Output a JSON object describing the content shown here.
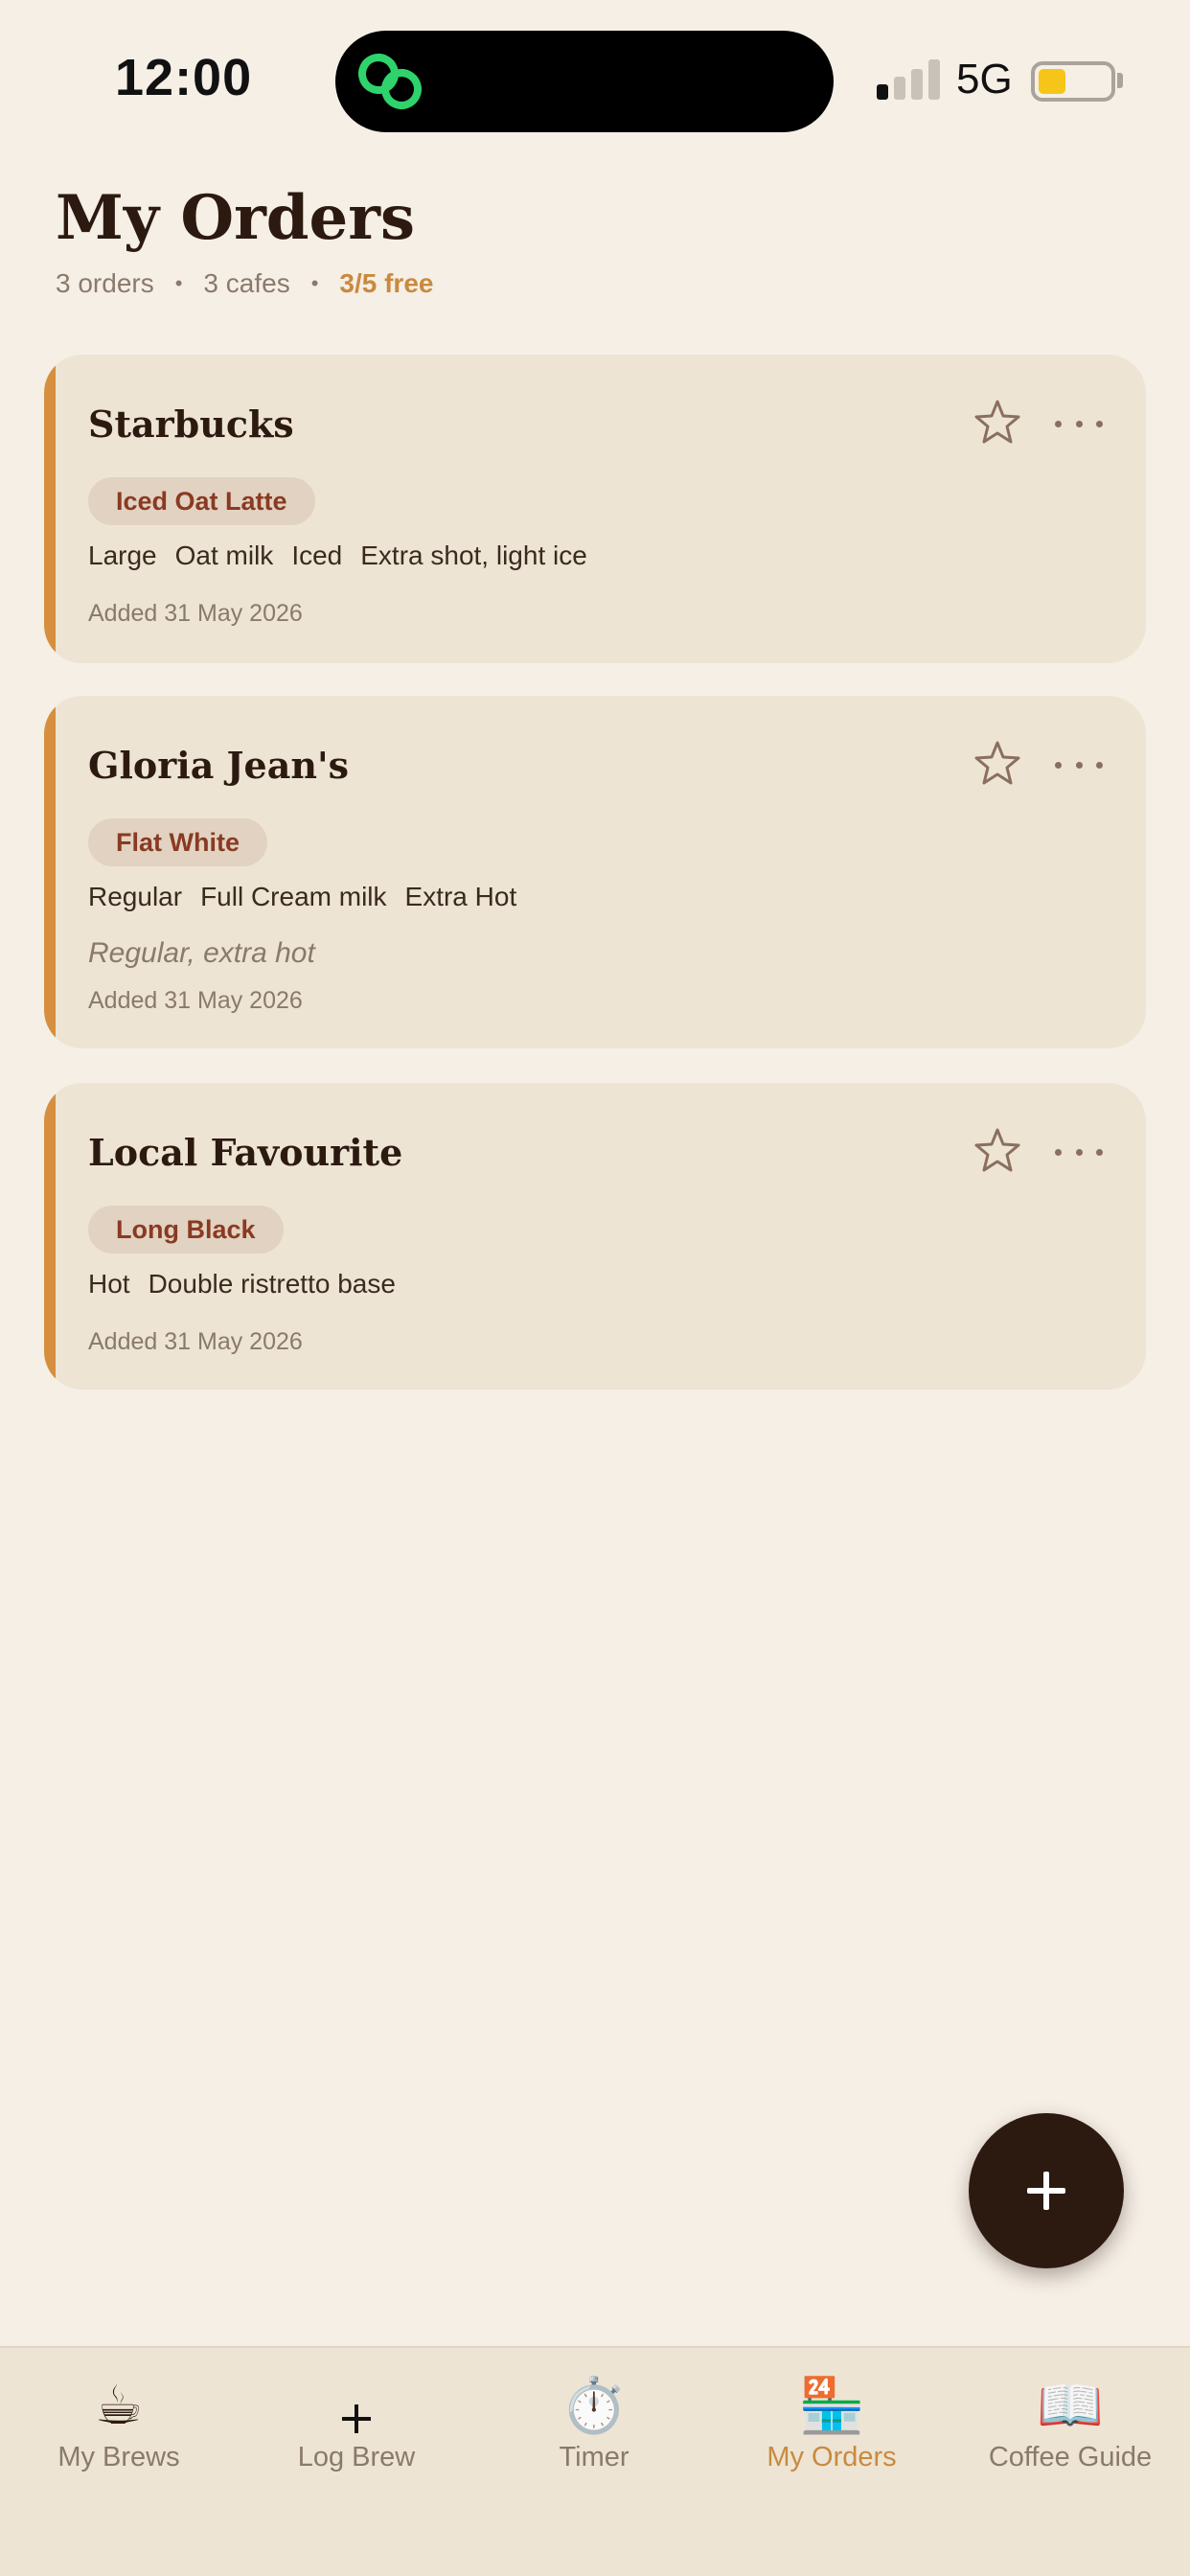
{
  "status": {
    "time": "12:00",
    "network": "5G"
  },
  "header": {
    "title": "My Orders",
    "orders_count": "3 orders",
    "cafes_count": "3 cafes",
    "free_count": "3/5 free",
    "separator": "•"
  },
  "orders": [
    {
      "cafe": "Starbucks",
      "drink": "Iced Oat Latte",
      "tags": [
        "Large",
        "Oat milk",
        "Iced",
        "Extra shot, light ice"
      ],
      "note": "",
      "added": "Added 31 May 2026"
    },
    {
      "cafe": "Gloria Jean's",
      "drink": "Flat White",
      "tags": [
        "Regular",
        "Full Cream milk",
        "Extra Hot"
      ],
      "note": "Regular, extra hot",
      "added": "Added 31 May 2026"
    },
    {
      "cafe": "Local Favourite",
      "drink": "Long Black",
      "tags": [
        "Hot",
        "Double ristretto base"
      ],
      "note": "",
      "added": "Added 31 May 2026"
    }
  ],
  "tabs": [
    {
      "label": "My Brews",
      "icon": "☕",
      "icon_name": "coffee-cup-icon"
    },
    {
      "label": "Log Brew",
      "icon": "",
      "icon_name": "plus-icon"
    },
    {
      "label": "Timer",
      "icon": "⏱️",
      "icon_name": "stopwatch-icon"
    },
    {
      "label": "My Orders",
      "icon": "🏪",
      "icon_name": "store-icon",
      "active": true
    },
    {
      "label": "Coffee Guide",
      "icon": "📖",
      "icon_name": "book-icon"
    }
  ],
  "colors": {
    "background": "#f6efe6",
    "card": "#ede4d4",
    "accent": "#d58f3f",
    "accent_text": "#c98a3e",
    "pill_bg": "#e2d2c2",
    "pill_text": "#8a3a22",
    "dark": "#2c1a10"
  }
}
